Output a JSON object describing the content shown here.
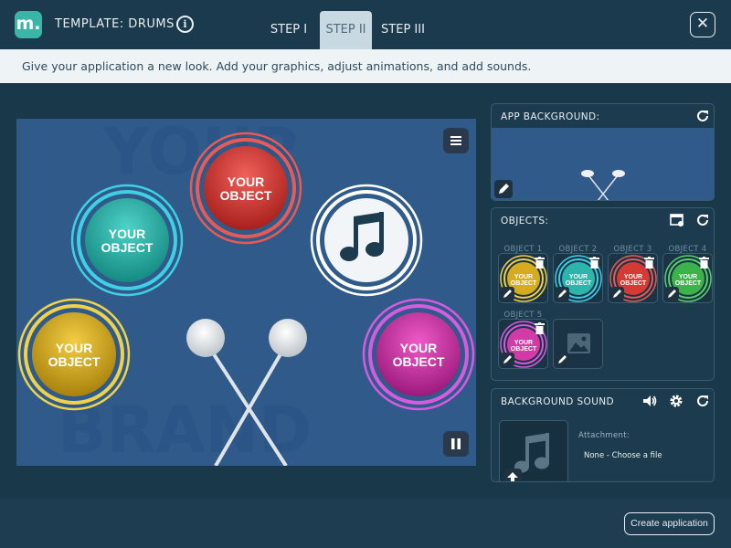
{
  "header": {
    "logo_text": "m.",
    "app_title": "TEMPLATE: DRUMS",
    "info_icon": "info-icon",
    "tabs": [
      {
        "label": "STEP I",
        "active": false
      },
      {
        "label": "STEP II",
        "active": true
      },
      {
        "label": "STEP III",
        "active": false
      }
    ],
    "close_icon": "close-icon"
  },
  "subbar": {
    "text": "Give your application a new look. Add your graphics, adjust animations, and add sounds."
  },
  "stage": {
    "background_color": "#2f5a8a",
    "watermark_lines": [
      "YOUR",
      "BRAND"
    ],
    "objects": [
      {
        "label_line1": "YOUR",
        "label_line2": "OBJECT",
        "color": "#d63a35",
        "ring": "#e85a55"
      },
      {
        "label_line1": "YOUR",
        "label_line2": "OBJECT",
        "color": "#2bb5ad",
        "ring": "#3fd0e6"
      },
      {
        "label_line1": "YOUR",
        "label_line2": "OBJECT",
        "color": "#d6ac1e",
        "ring": "#f0d24a"
      },
      {
        "label_line1": "YOUR",
        "label_line2": "OBJECT",
        "color": "#d23aa8",
        "ring": "#d85ae0"
      },
      {
        "label_line1": "",
        "label_line2": "",
        "color": "#f2f5f7",
        "ring": "#ffffff",
        "icon": "music-note-icon"
      }
    ],
    "menu_icon": "hamburger-icon",
    "pause_icon": "pause-icon"
  },
  "panels": {
    "app_background": {
      "title": "APP BACKGROUND:",
      "reset_icon": "refresh-icon",
      "edit_icon": "pencil-icon"
    },
    "objects": {
      "title": "OBJECTS:",
      "settings_icon": "object-settings-icon",
      "reset_icon": "refresh-icon",
      "items": [
        {
          "label": "OBJECT 1",
          "color": "#d6ac1e",
          "ring": "#f0d24a"
        },
        {
          "label": "OBJECT 2",
          "color": "#2bb5ad",
          "ring": "#3fd0e6"
        },
        {
          "label": "OBJECT 3",
          "color": "#d63a35",
          "ring": "#e85a55"
        },
        {
          "label": "OBJECT 4",
          "color": "#3bb34a",
          "ring": "#5ad06a"
        },
        {
          "label": "OBJECT 5",
          "color": "#d23aa8",
          "ring": "#d85ae0"
        }
      ],
      "thumb_text_1": "YOUR",
      "thumb_text_2": "OBJECT",
      "add_icon": "image-placeholder-icon"
    },
    "background_sound": {
      "title": "BACKGROUND SOUND",
      "volume_icon": "speaker-icon",
      "settings_icon": "gear-icon",
      "reset_icon": "refresh-icon",
      "attachment_label": "Attachment:",
      "attachment_value": "None - Choose a file",
      "upload_icon": "upload-icon"
    }
  },
  "footer": {
    "create_label": "Create application"
  },
  "colors": {
    "accent": "#3bb5a8",
    "background": "#19384a"
  }
}
